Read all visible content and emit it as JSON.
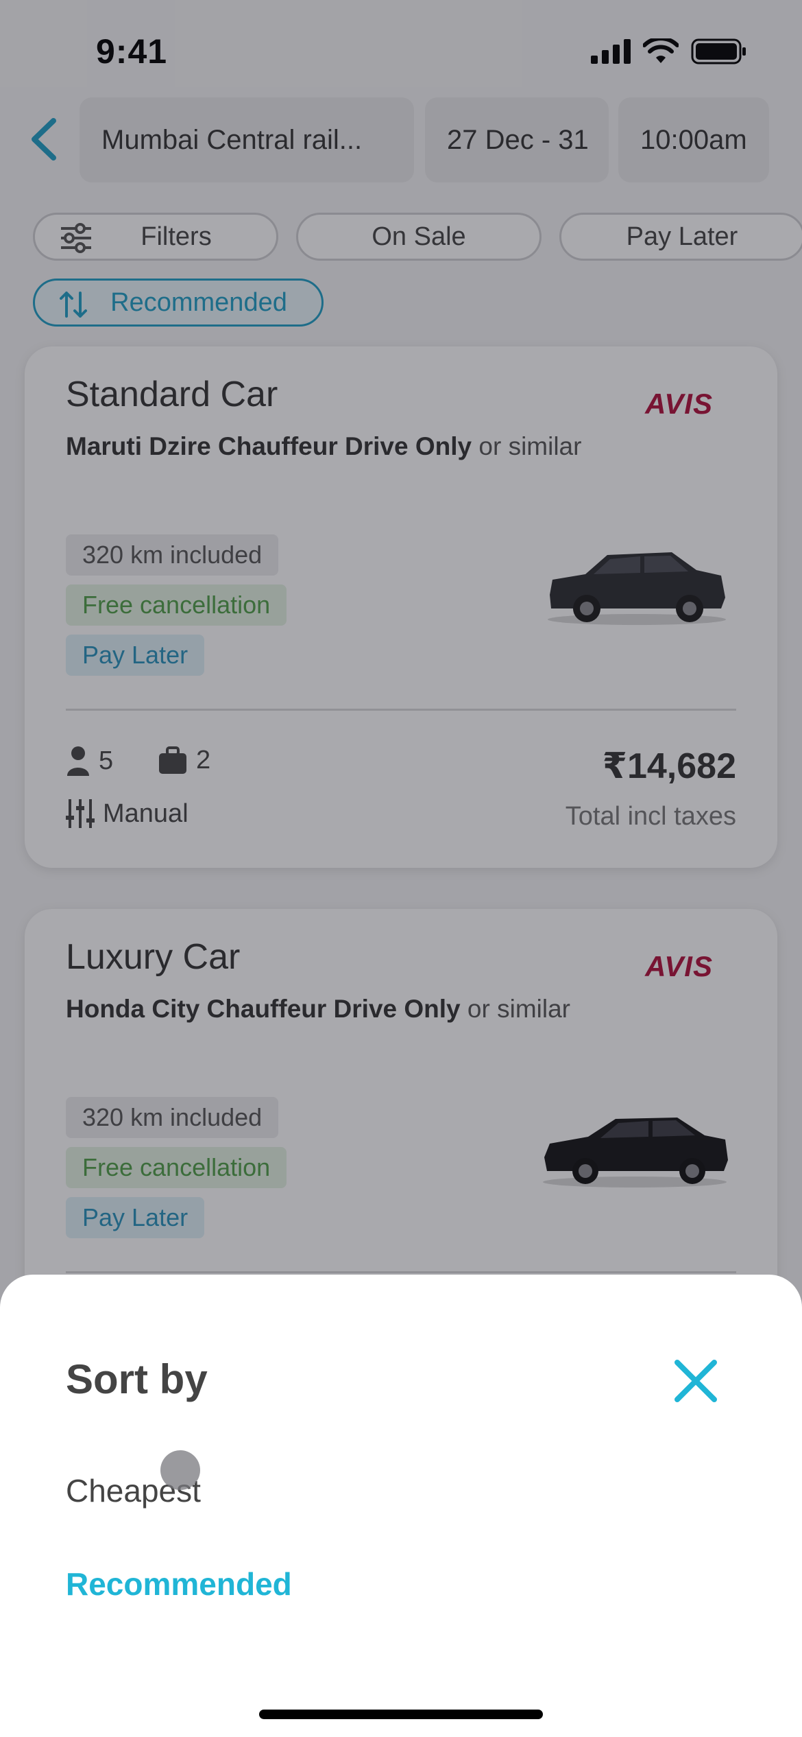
{
  "status_bar": {
    "time": "9:41"
  },
  "search": {
    "location": "Mumbai Central rail...",
    "dates": "27 Dec - 31",
    "time": "10:00am"
  },
  "chips": {
    "filters": "Filters",
    "on_sale": "On Sale",
    "pay_later": "Pay Later",
    "recommended": "Recommended"
  },
  "cards": [
    {
      "class": "Standard Car",
      "brand": "AVIS",
      "model": "Maruti Dzire Chauffeur Drive Only",
      "similar": "or similar",
      "km": "320 km included",
      "free_cancel": "Free cancellation",
      "pay_later": "Pay Later",
      "seats": "5",
      "bags": "2",
      "transmission": "Manual",
      "price": "₹14,682",
      "price_note": "Total incl taxes"
    },
    {
      "class": "Luxury Car",
      "brand": "AVIS",
      "model": "Honda City Chauffeur Drive Only",
      "similar": "or similar",
      "km": "320 km included",
      "free_cancel": "Free cancellation",
      "pay_later": "Pay Later"
    }
  ],
  "sheet": {
    "title": "Sort by",
    "options": [
      "Cheapest",
      "Recommended"
    ],
    "selected": "Recommended"
  },
  "colors": {
    "accent": "#1f9ec6",
    "selected_option": "#20b5d6",
    "brand": "#b0103a",
    "free_cancel": "#4f9e47"
  }
}
